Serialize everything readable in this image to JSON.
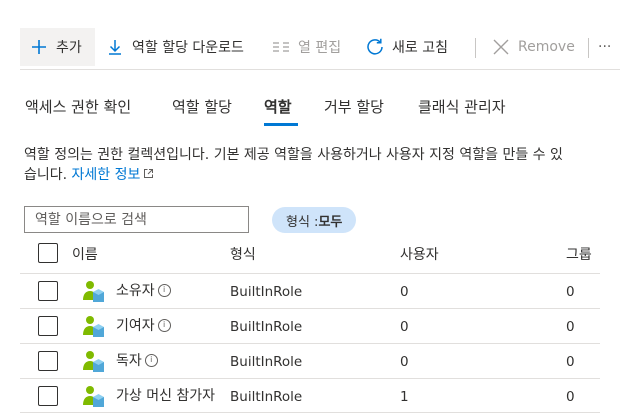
{
  "toolbar": {
    "add": "추가",
    "download": "역할 할당 다운로드",
    "edit_columns": "열 편집",
    "refresh": "새로 고침",
    "remove": "Remove",
    "more": "···"
  },
  "tabs": [
    {
      "label": "액세스 권한 확인",
      "active": false
    },
    {
      "label": "역할 할당",
      "active": false
    },
    {
      "label": "역할",
      "active": true
    },
    {
      "label": "거부 할당",
      "active": false
    },
    {
      "label": "클래식 관리자",
      "active": false
    }
  ],
  "description": {
    "line1": "역할 정의는 권한 컬렉션입니다. 기본 제공 역할을 사용하거나 사용자 지정 역할을 만들 수 있",
    "line2": "습니다. ",
    "link": "자세한 정보"
  },
  "search": {
    "placeholder": "역할 이름으로 검색",
    "value": ""
  },
  "filter": {
    "label": "형식 : ",
    "value": "모두"
  },
  "table": {
    "headers": [
      "이름",
      "형식",
      "사용자",
      "그룹"
    ],
    "rows": [
      {
        "name": "소유자",
        "type": "BuiltInRole",
        "users": "0",
        "groups": "0"
      },
      {
        "name": "기여자",
        "type": "BuiltInRole",
        "users": "0",
        "groups": "0"
      },
      {
        "name": "독자",
        "type": "BuiltInRole",
        "users": "0",
        "groups": "0"
      },
      {
        "name": "가상 머신 참가자",
        "type": "BuiltInRole",
        "users": "1",
        "groups": "0"
      }
    ]
  },
  "colors": {
    "accent": "#0078d4",
    "pill": "#cfe4fa",
    "icon_green": "#7fba00",
    "icon_blue": "#50a7d8"
  },
  "icons": [
    "plus-icon",
    "download-icon",
    "columns-icon",
    "refresh-icon",
    "close-icon",
    "external-link-icon",
    "info-icon",
    "role-icon"
  ]
}
